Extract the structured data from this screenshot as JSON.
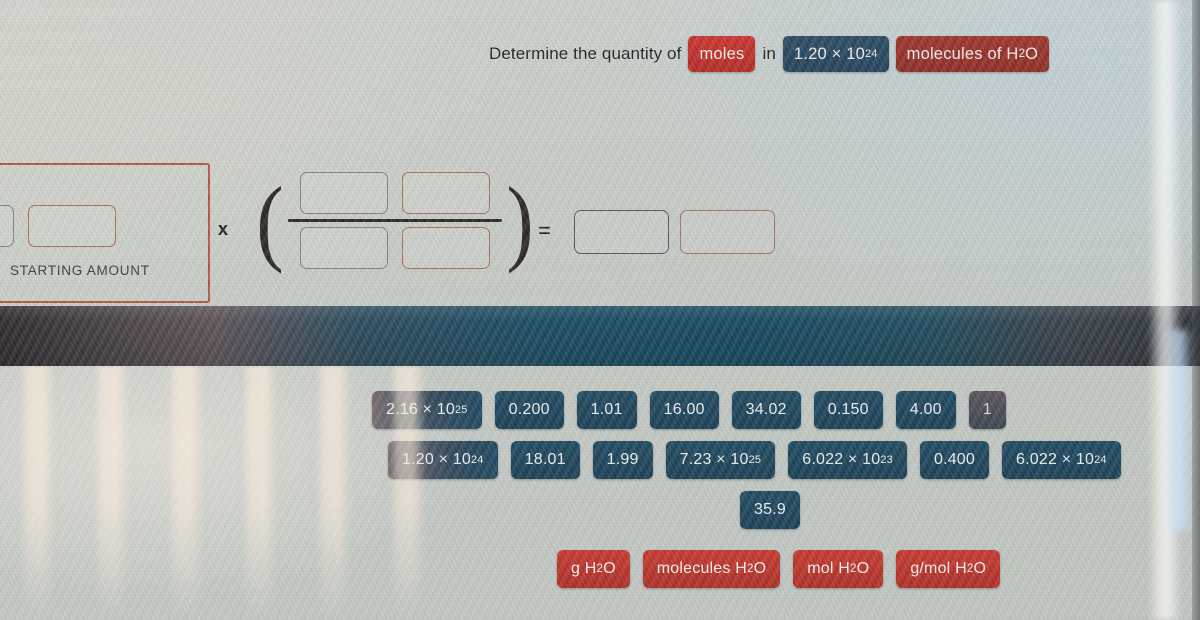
{
  "question": {
    "lead": "Determine the quantity of",
    "target_chip": "moles",
    "connector": "in",
    "value_chip": "1.20 × 10",
    "value_chip_exp": "24",
    "species_chip_pre": "molecules of H",
    "species_chip_sub": "2",
    "species_chip_post": "O"
  },
  "workspace": {
    "starting_amount_label": "STARTING AMOUNT",
    "times_symbol": "x",
    "equals_symbol": "=",
    "left_paren": "(",
    "right_paren": ")"
  },
  "tiles": {
    "row1": [
      {
        "text": "2.16 × 10",
        "exp": "25",
        "style": "faded2"
      },
      {
        "text": "0.200",
        "exp": "",
        "style": "normal"
      },
      {
        "text": "1.01",
        "exp": "",
        "style": "normal"
      },
      {
        "text": "16.00",
        "exp": "",
        "style": "normal"
      },
      {
        "text": "34.02",
        "exp": "",
        "style": "normal"
      },
      {
        "text": "0.150",
        "exp": "",
        "style": "normal"
      },
      {
        "text": "4.00",
        "exp": "",
        "style": "normal"
      },
      {
        "text": "1",
        "exp": "",
        "style": "faded"
      }
    ],
    "row2": [
      {
        "text": "1.20 × 10",
        "exp": "24",
        "style": "faded2"
      },
      {
        "text": "18.01",
        "exp": "",
        "style": "normal"
      },
      {
        "text": "1.99",
        "exp": "",
        "style": "normal"
      },
      {
        "text": "7.23 × 10",
        "exp": "25",
        "style": "normal"
      },
      {
        "text": "6.022 × 10",
        "exp": "23",
        "style": "normal"
      },
      {
        "text": "0.400",
        "exp": "",
        "style": "normal"
      },
      {
        "text": "6.022 × 10",
        "exp": "24",
        "style": "normal"
      }
    ],
    "row3": [
      {
        "text": "35.9",
        "exp": "",
        "style": "normal"
      }
    ],
    "units": [
      {
        "pre": "g H",
        "sub": "2",
        "post": "O"
      },
      {
        "pre": "molecules H",
        "sub": "2",
        "post": "O"
      },
      {
        "pre": "mol H",
        "sub": "2",
        "post": "O"
      },
      {
        "pre": "g/mol H",
        "sub": "2",
        "post": "O"
      }
    ]
  },
  "colors": {
    "navy_tile": "#21495f",
    "red_tile": "#c4382e",
    "dark_red_chip": "#9d342c",
    "panel_border": "#b2553f",
    "band": "#1b4a61"
  }
}
